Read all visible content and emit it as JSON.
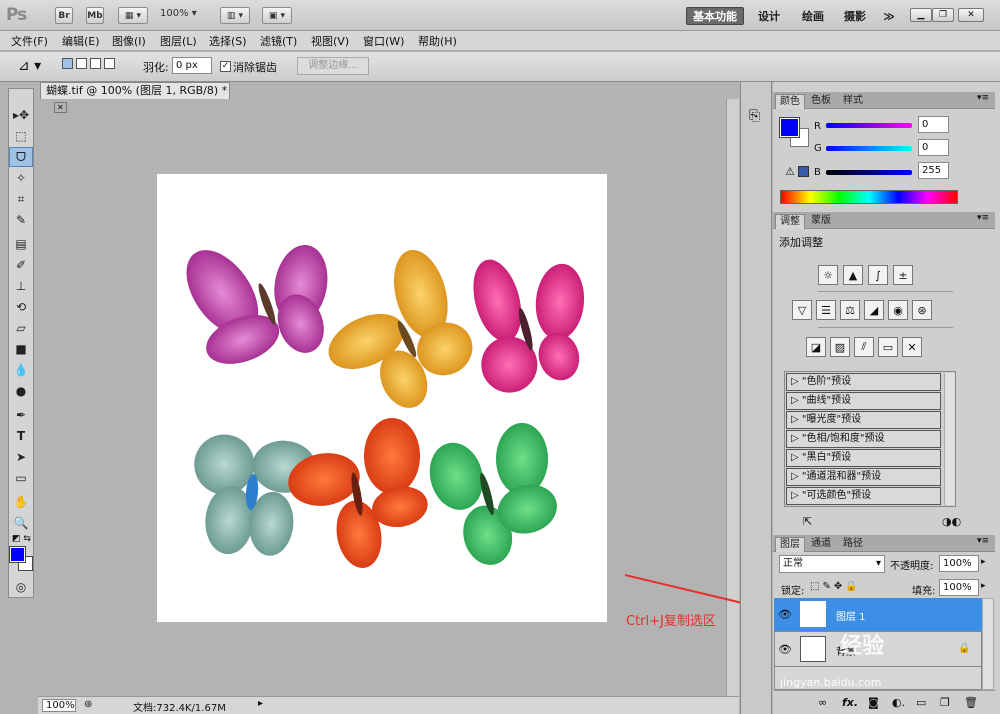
{
  "app": {
    "logo": "Ps",
    "bridge": "Br",
    "minibridge": "Mb",
    "zoom": "100%",
    "workspaces": [
      "基本功能",
      "设计",
      "绘画",
      "摄影"
    ],
    "more": "≫"
  },
  "menu": [
    "文件(F)",
    "编辑(E)",
    "图像(I)",
    "图层(L)",
    "选择(S)",
    "滤镜(T)",
    "视图(V)",
    "窗口(W)",
    "帮助(H)"
  ],
  "options": {
    "feather_label": "羽化:",
    "feather_value": "0 px",
    "antialias_label": "消除锯齿",
    "refine_edge": "调整边缘..."
  },
  "document": {
    "tab_title": "蝴蝶.tif @ 100% (图层 1, RGB/8) *",
    "zoom": "100%",
    "doc_info": "文档:732.4K/1.67M"
  },
  "annotation": {
    "text": "Ctrl+J复制选区",
    "color": "#e8302a"
  },
  "color_panel": {
    "tabs": [
      "颜色",
      "色板",
      "样式"
    ],
    "r_label": "R",
    "r_value": "0",
    "g_label": "G",
    "g_value": "0",
    "b_label": "B",
    "b_value": "255",
    "foreground": "#0000ff"
  },
  "adjust_panel": {
    "tabs": [
      "调整",
      "蒙版"
    ],
    "title": "添加调整",
    "presets": [
      "\"色阶\"预设",
      "\"曲线\"预设",
      "\"曝光度\"预设",
      "\"色相/饱和度\"预设",
      "\"黑白\"预设",
      "\"通道混和器\"预设",
      "\"可选颜色\"预设"
    ]
  },
  "layers_panel": {
    "tabs": [
      "图层",
      "通道",
      "路径"
    ],
    "blend_mode": "正常",
    "opacity_label": "不透明度:",
    "opacity_value": "100%",
    "lock_label": "锁定:",
    "fill_label": "填充:",
    "fill_value": "100%",
    "layers": [
      {
        "name": "图层 1",
        "selected": true
      },
      {
        "name": "背景",
        "selected": false
      }
    ],
    "bottom_icons": [
      "link-icon",
      "fx-icon",
      "mask-icon",
      "adjustment-icon",
      "group-icon",
      "new-layer-icon",
      "trash-icon"
    ]
  },
  "watermark": {
    "text": "经验",
    "sub": "jingyan.baidu.com"
  }
}
